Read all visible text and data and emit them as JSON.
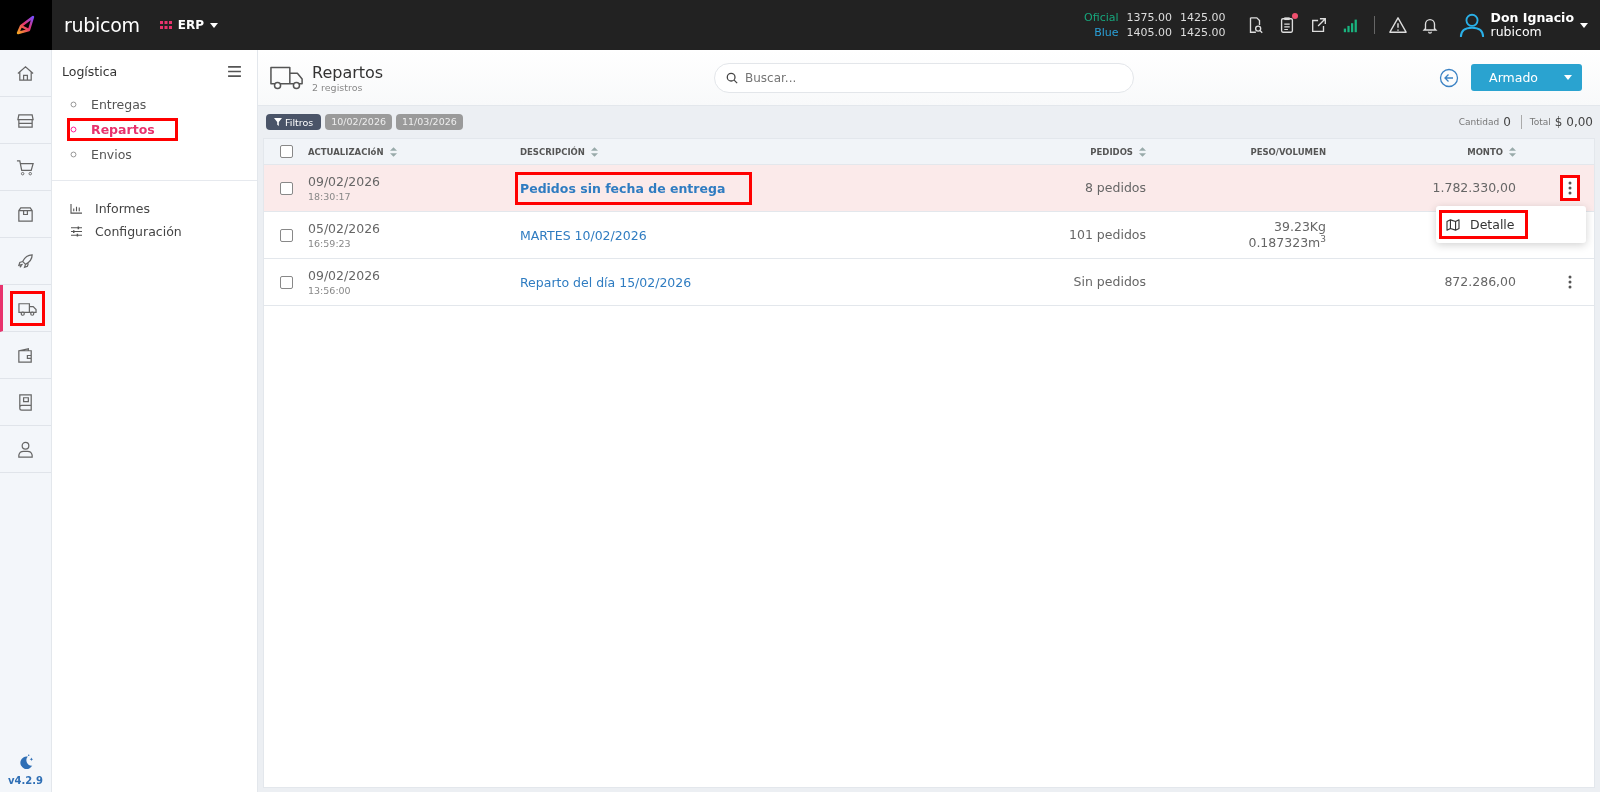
{
  "topbar": {
    "app_name": "rubicom",
    "module": "ERP",
    "rates": [
      {
        "name": "Oficial",
        "color": "#17a67c",
        "buy": "1375.00",
        "sell": "1425.00"
      },
      {
        "name": "Blue",
        "color": "#2aa0d8",
        "buy": "1405.00",
        "sell": "1425.00"
      }
    ],
    "notification_dot": true,
    "user": {
      "name": "Don Ignacio",
      "company": "rubicom"
    }
  },
  "rail": {
    "items": [
      {
        "selected": false,
        "highlighted": false
      },
      {
        "selected": false,
        "highlighted": false
      },
      {
        "selected": false,
        "highlighted": false
      },
      {
        "selected": false,
        "highlighted": false
      },
      {
        "selected": false,
        "highlighted": false
      },
      {
        "selected": true,
        "highlighted": true
      },
      {
        "selected": false,
        "highlighted": false
      },
      {
        "selected": false,
        "highlighted": false
      },
      {
        "selected": false,
        "highlighted": false
      }
    ],
    "version": "v4.2.9"
  },
  "submenu": {
    "title": "Logística",
    "items": [
      {
        "label": "Entregas",
        "selected": false,
        "highlighted": false
      },
      {
        "label": "Repartos",
        "selected": true,
        "highlighted": true
      },
      {
        "label": "Envios",
        "selected": false,
        "highlighted": false
      }
    ],
    "links": [
      "Informes",
      "Configuración"
    ]
  },
  "page": {
    "title": "Repartos",
    "subtitle": "2 registros",
    "search": {
      "placeholder": "Buscar..."
    },
    "primary_button": "Armado"
  },
  "filters": {
    "button": "Filtros",
    "chips": [
      "10/02/2026",
      "11/03/2026"
    ],
    "summary": {
      "count_label": "Cantidad",
      "count": "0",
      "total_label": "Total",
      "total": "$ 0,00"
    }
  },
  "table": {
    "all_checked": false,
    "columns": [
      {
        "label": "ACTUALIZACIóN",
        "sortable": true
      },
      {
        "label": "DESCRIPCIÓN",
        "sortable": true
      },
      {
        "label": "PEDIDOS",
        "sortable": true
      },
      {
        "label": "PESO/VOLUMEN",
        "sortable": false
      },
      {
        "label": "MONTO",
        "sortable": true
      }
    ],
    "rows": [
      {
        "checked": false,
        "active": true,
        "date": "09/02/2026",
        "time": "18:30:17",
        "description": "Pedidos sin fecha de entrega",
        "description_highlighted": true,
        "pedidos": "8 pedidos",
        "weight": "",
        "volume": "",
        "monto": "1.782.330,00",
        "actions_highlighted": true,
        "menu_open": true,
        "menu": [
          {
            "label": "Detalle",
            "highlighted": true
          }
        ]
      },
      {
        "checked": false,
        "active": false,
        "date": "05/02/2026",
        "time": "16:59:23",
        "description": "MARTES 10/02/2026",
        "description_highlighted": false,
        "pedidos": "101 pedidos",
        "weight": "39.23Kg",
        "volume": "0.187323m$^{3}$",
        "monto": "",
        "actions_highlighted": false,
        "menu_open": false,
        "menu": []
      },
      {
        "checked": false,
        "active": false,
        "date": "09/02/2026",
        "time": "13:56:00",
        "description": "Reparto del día 15/02/2026",
        "description_highlighted": false,
        "pedidos": "Sin pedidos",
        "weight": "",
        "volume": "",
        "monto": "872.286,00",
        "actions_highlighted": false,
        "menu_open": false,
        "menu": []
      }
    ]
  }
}
